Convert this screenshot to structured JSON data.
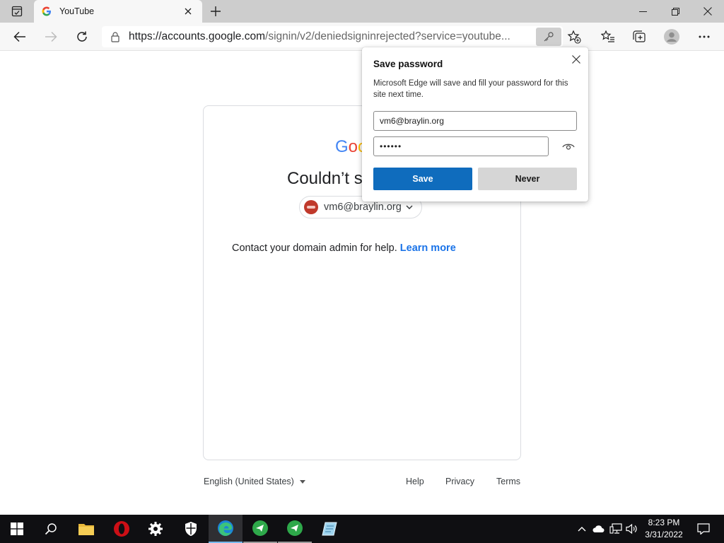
{
  "browser": {
    "tab": {
      "title": "YouTube"
    },
    "address": {
      "url_host": "https://accounts.google.com",
      "url_path": "/signin/v2/deniedsigninrejected?service=youtube..."
    }
  },
  "page": {
    "logo_letters": [
      "G",
      "o",
      "o"
    ],
    "logo_colors": [
      "#4285F4",
      "#EA4335",
      "#FBBC05"
    ],
    "heading": "Couldn’t s",
    "account_email": "vm6@braylin.org",
    "help_text": "Contact your domain admin for help.",
    "learn_more": "Learn more",
    "footer": {
      "language": "English (United States)",
      "help": "Help",
      "privacy": "Privacy",
      "terms": "Terms"
    }
  },
  "popup": {
    "title": "Save password",
    "description": "Microsoft Edge will save and fill your password for this site next time.",
    "username_value": "vm6@braylin.org",
    "password_value": "••••••",
    "save_label": "Save",
    "never_label": "Never"
  },
  "taskbar": {
    "time": "8:23 PM",
    "date": "3/31/2022"
  },
  "colors": {
    "save_button": "#0f6cbd",
    "link": "#1a73e8",
    "taskbar": "#0f0f12"
  }
}
